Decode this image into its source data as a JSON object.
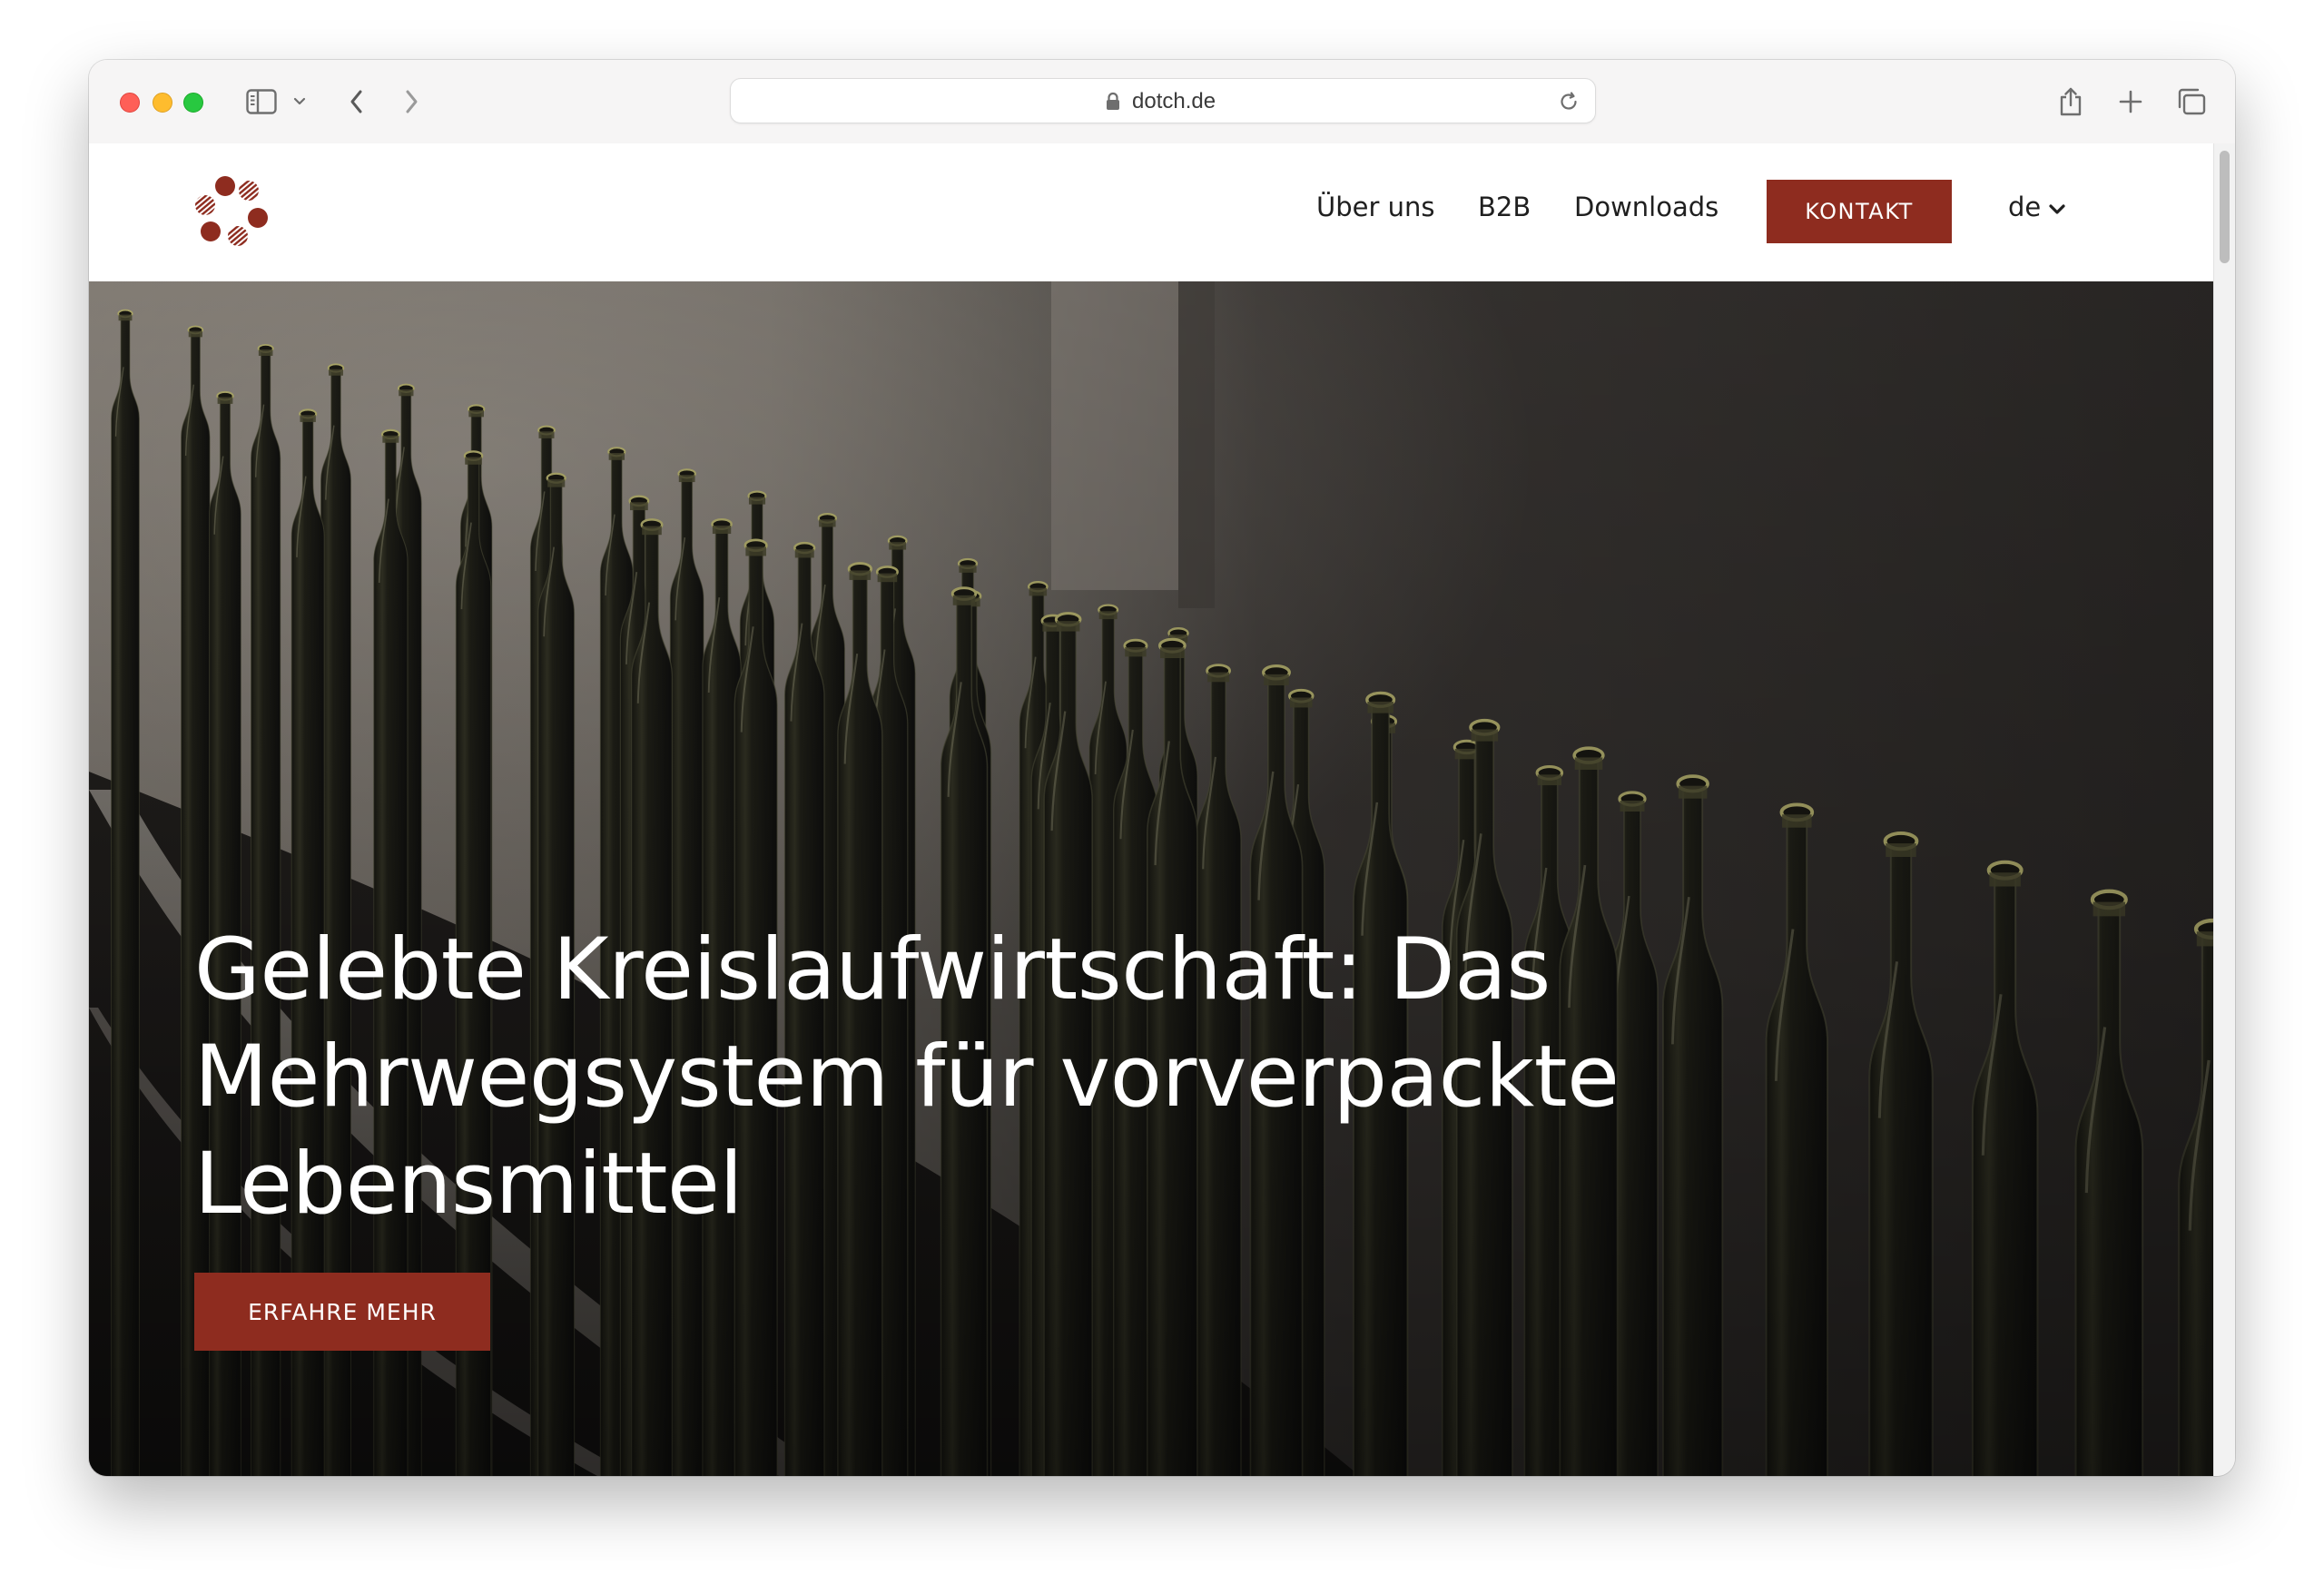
{
  "browser": {
    "url": "dotch.de",
    "icons": {
      "sidebar": "sidebar-icon",
      "sidebar_menu": "chevron-down-icon",
      "back": "chevron-left-icon",
      "forward": "chevron-right-icon",
      "lock": "lock-icon",
      "reload": "reload-icon",
      "share": "share-icon",
      "new_tab": "plus-icon",
      "tabs": "tabs-overview-icon"
    }
  },
  "site": {
    "logo": "dotch-logo",
    "nav": {
      "about": "Über uns",
      "b2b": "B2B",
      "downloads": "Downloads",
      "contact": "KONTAKT",
      "language": "de"
    },
    "hero": {
      "title_line1": "Gelebte Kreislaufwirtschaft: Das",
      "title_line2": "Mehrwegsystem für vorverpackte",
      "title_line3": "Lebensmittel",
      "cta": "ERFAHRE MEHR",
      "image": "glass-bottles-on-conveyor-belt"
    }
  },
  "colors": {
    "brand": "#8e2c1f",
    "text": "#1f1f1f",
    "hero_text": "#ffffff"
  }
}
